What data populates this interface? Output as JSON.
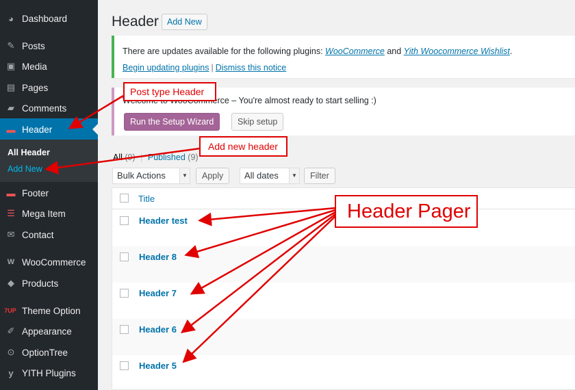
{
  "sidebar": {
    "items": [
      {
        "label": "Dashboard",
        "icon": "dashboard-icon",
        "glyph": "◕"
      },
      {
        "label": "Posts",
        "icon": "pin-icon",
        "glyph": "✎"
      },
      {
        "label": "Media",
        "icon": "media-icon",
        "glyph": "▣"
      },
      {
        "label": "Pages",
        "icon": "pages-icon",
        "glyph": "▤"
      },
      {
        "label": "Comments",
        "icon": "comments-icon",
        "glyph": "▰"
      },
      {
        "label": "Header",
        "icon": "header-icon",
        "glyph": "▬"
      },
      {
        "label": "Footer",
        "icon": "footer-icon",
        "glyph": "▬"
      },
      {
        "label": "Mega Item",
        "icon": "mega-item-icon",
        "glyph": "☰"
      },
      {
        "label": "Contact",
        "icon": "mail-icon",
        "glyph": "✉"
      },
      {
        "label": "WooCommerce",
        "icon": "woocommerce-icon",
        "glyph": "W"
      },
      {
        "label": "Products",
        "icon": "products-icon",
        "glyph": "◆"
      },
      {
        "label": "Theme Option",
        "icon": "theme-option-icon",
        "glyph": "7UP"
      },
      {
        "label": "Appearance",
        "icon": "appearance-icon",
        "glyph": "✐"
      },
      {
        "label": "OptionTree",
        "icon": "optiontree-icon",
        "glyph": "⊙"
      },
      {
        "label": "YITH Plugins",
        "icon": "yith-icon",
        "glyph": "y"
      }
    ],
    "submenu": {
      "all": "All Header",
      "add_new": "Add New"
    }
  },
  "header": {
    "title": "Header",
    "add_new": "Add New"
  },
  "notice": {
    "text_before": "There are updates available for the following plugins: ",
    "plugin1": "WooCommerce",
    "and": " and ",
    "plugin2": "Yith Woocommerce Wishlist",
    "period": ".",
    "begin": "Begin updating plugins",
    "sep": "|",
    "dismiss": "Dismiss this notice"
  },
  "wc_notice": {
    "message": "Welcome to WooCommerce – You're almost ready to start selling :)",
    "wizard": "Run the Setup Wizard",
    "skip": "Skip setup"
  },
  "filters": {
    "all": "All",
    "all_count": "(9)",
    "sep": "|",
    "published": "Published",
    "published_count": "(9)",
    "bulk": "Bulk Actions",
    "apply": "Apply",
    "dates": "All dates",
    "filter": "Filter"
  },
  "table": {
    "col_title": "Title",
    "rows": [
      "Header test",
      "Header 8",
      "Header 7",
      "Header 6",
      "Header 5"
    ]
  },
  "annotations": {
    "post_type": "Post type Header",
    "add_new_header": "Add new header",
    "pager": "Header Pager"
  },
  "colors": {
    "sidebar_bg": "#23282d",
    "active": "#0073aa",
    "annotation": "#e00000",
    "wc_purple": "#a46497"
  }
}
